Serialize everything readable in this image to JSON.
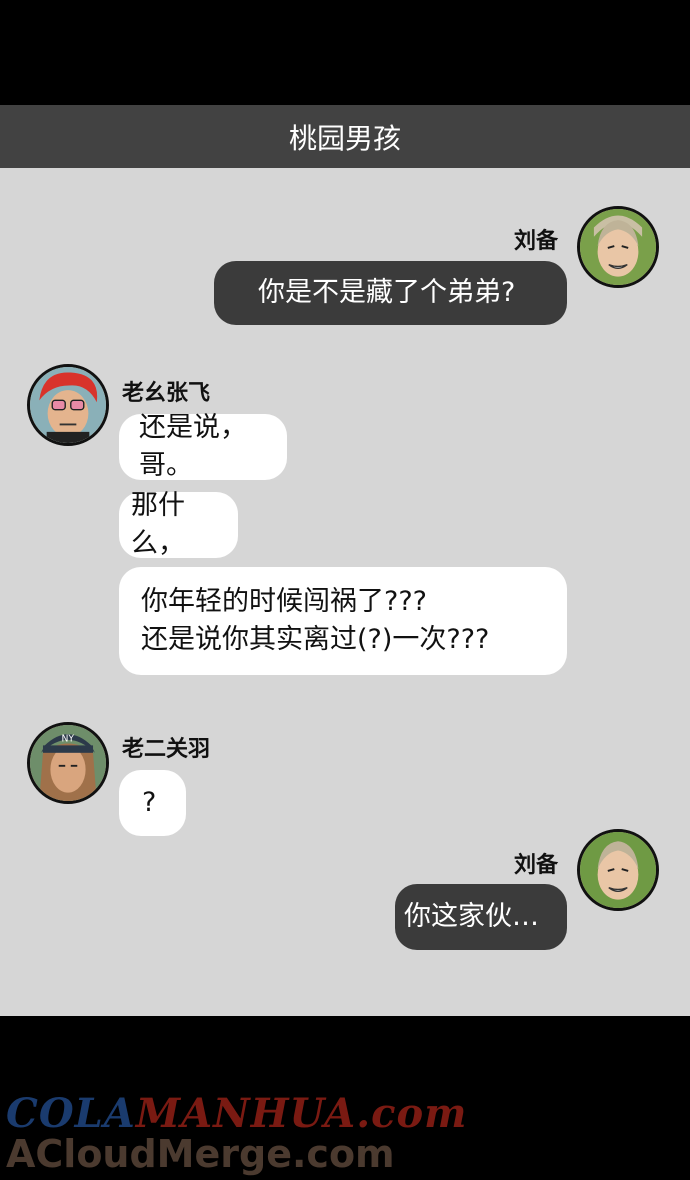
{
  "header": {
    "title": "桃园男孩"
  },
  "messages": [
    {
      "sender": "刘备",
      "side": "right",
      "bubbles": [
        "你是不是藏了个弟弟?"
      ]
    },
    {
      "sender": "老幺张飞",
      "side": "left",
      "bubbles": [
        "还是说，哥。",
        "那什么，",
        "你年轻的时候闯祸了???\n还是说你其实离过(?)一次???"
      ]
    },
    {
      "sender": "老二关羽",
      "side": "left",
      "bubbles": [
        "?"
      ]
    },
    {
      "sender": "刘备",
      "side": "right",
      "bubbles": [
        "你这家伙…"
      ]
    }
  ],
  "avatars": {
    "liubei": "liubei-avatar-icon",
    "zhangfei": "zhangfei-avatar-icon",
    "guanyu": "guanyu-avatar-icon"
  },
  "colors": {
    "header_bg": "#424242",
    "chat_bg": "#d6d6d6",
    "dark_bubble": "#3b3b3b",
    "light_bubble": "#ffffff"
  },
  "watermark": {
    "part1": "COLA",
    "part2": "MANHUA.com",
    "line2": "ACloudMerge.com"
  }
}
